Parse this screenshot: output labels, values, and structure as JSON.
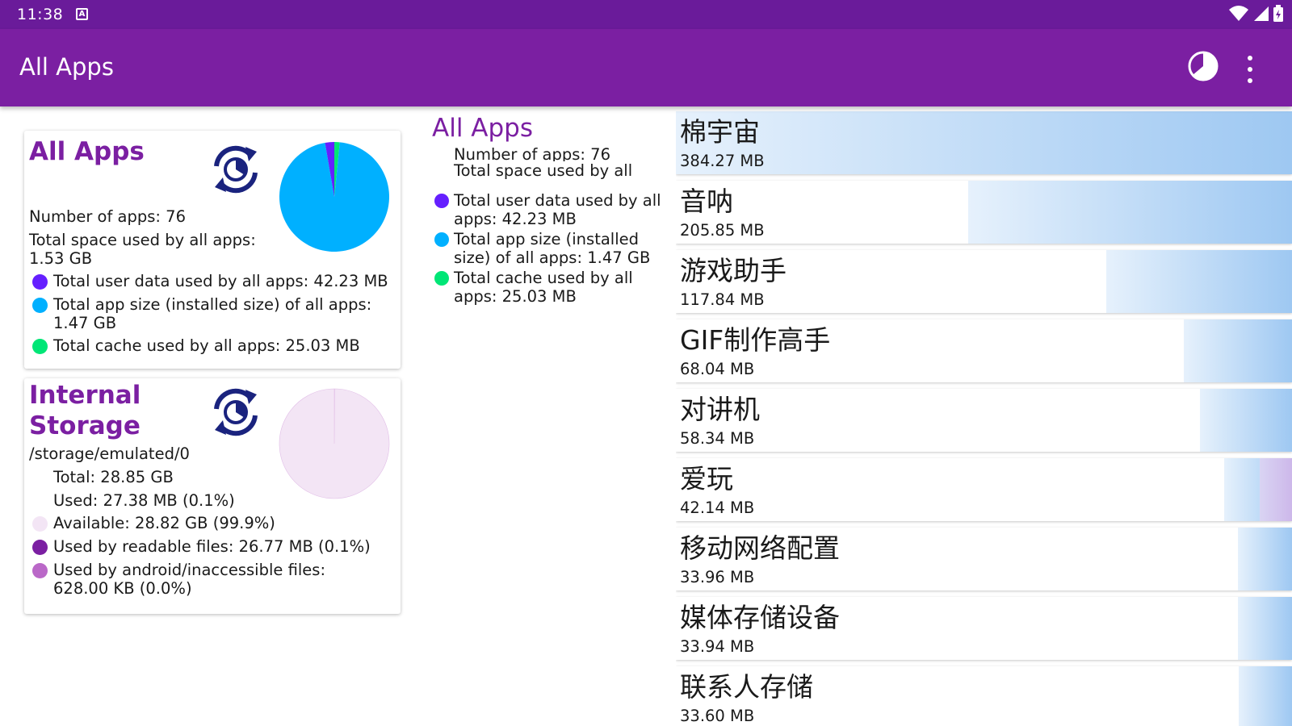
{
  "status_bar": {
    "time": "11:38",
    "notification_icon": "a-icon",
    "icons": [
      "wifi-icon",
      "signal-icon",
      "battery-icon"
    ]
  },
  "app_bar": {
    "title": "All Apps",
    "actions": [
      "pie-chart-icon",
      "more-vert-icon"
    ]
  },
  "all_apps_card": {
    "title": "All Apps",
    "num_apps": "Number of apps: 76",
    "total_space_1": "Total space used by all apps:",
    "total_space_2": "1.53 GB",
    "user_data": "Total user data used by all apps: 42.23 MB",
    "app_size_1": "Total app size (installed size) of all apps:",
    "app_size_2": "1.47 GB",
    "cache": "Total cache used by all apps: 25.03 MB",
    "legend_colors": {
      "user_data": "#651fff",
      "app_size": "#00b0ff",
      "cache": "#00e676"
    },
    "pie_fractions": {
      "user_data": 0.027,
      "app_size": 0.957,
      "cache": 0.016
    }
  },
  "storage_card": {
    "title_1": "Internal",
    "title_2": "Storage",
    "path": "/storage/emulated/0",
    "total": "Total: 28.85 GB",
    "used": "Used: 27.38 MB (0.1%)",
    "available": "Available: 28.82 GB (99.9%)",
    "readable": "Used by readable files: 26.77 MB (0.1%)",
    "android_1": "Used by android/inaccessible files:",
    "android_2": "628.00 KB (0.0%)",
    "legend_colors": {
      "available": "#f3e5f5",
      "readable": "#7b1fa2",
      "android": "#ba68c8"
    },
    "pie_fractions": {
      "available": 0.999,
      "used": 0.001
    }
  },
  "detail": {
    "title": "All Apps",
    "num_apps": "Number of apps: 76",
    "total_space": "Total space used by all",
    "user_data_1": "Total user data used by all",
    "user_data_2": "apps: 42.23 MB",
    "app_size_1": "Total app size (installed",
    "app_size_2": "size) of all apps: 1.47 GB",
    "cache_1": "Total cache used by all",
    "cache_2": "apps: 25.03 MB"
  },
  "apps": [
    {
      "name": "棉宇宙",
      "size": "384.27 MB",
      "fraction": 1.0
    },
    {
      "name": "音呐",
      "size": "205.85 MB",
      "fraction": 0.525
    },
    {
      "name": "游戏助手",
      "size": "117.84 MB",
      "fraction": 0.302
    },
    {
      "name": "GIF制作高手",
      "size": "68.04 MB",
      "fraction": 0.176
    },
    {
      "name": "对讲机",
      "size": "58.34 MB",
      "fraction": 0.15
    },
    {
      "name": "爱玩",
      "size": "42.14 MB",
      "fraction": 0.11
    },
    {
      "name": "移动网络配置",
      "size": "33.96 MB",
      "fraction": 0.088
    },
    {
      "name": "媒体存储设备",
      "size": "33.94 MB",
      "fraction": 0.088
    },
    {
      "name": "联系人存储",
      "size": "33.60 MB",
      "fraction": 0.087
    }
  ]
}
